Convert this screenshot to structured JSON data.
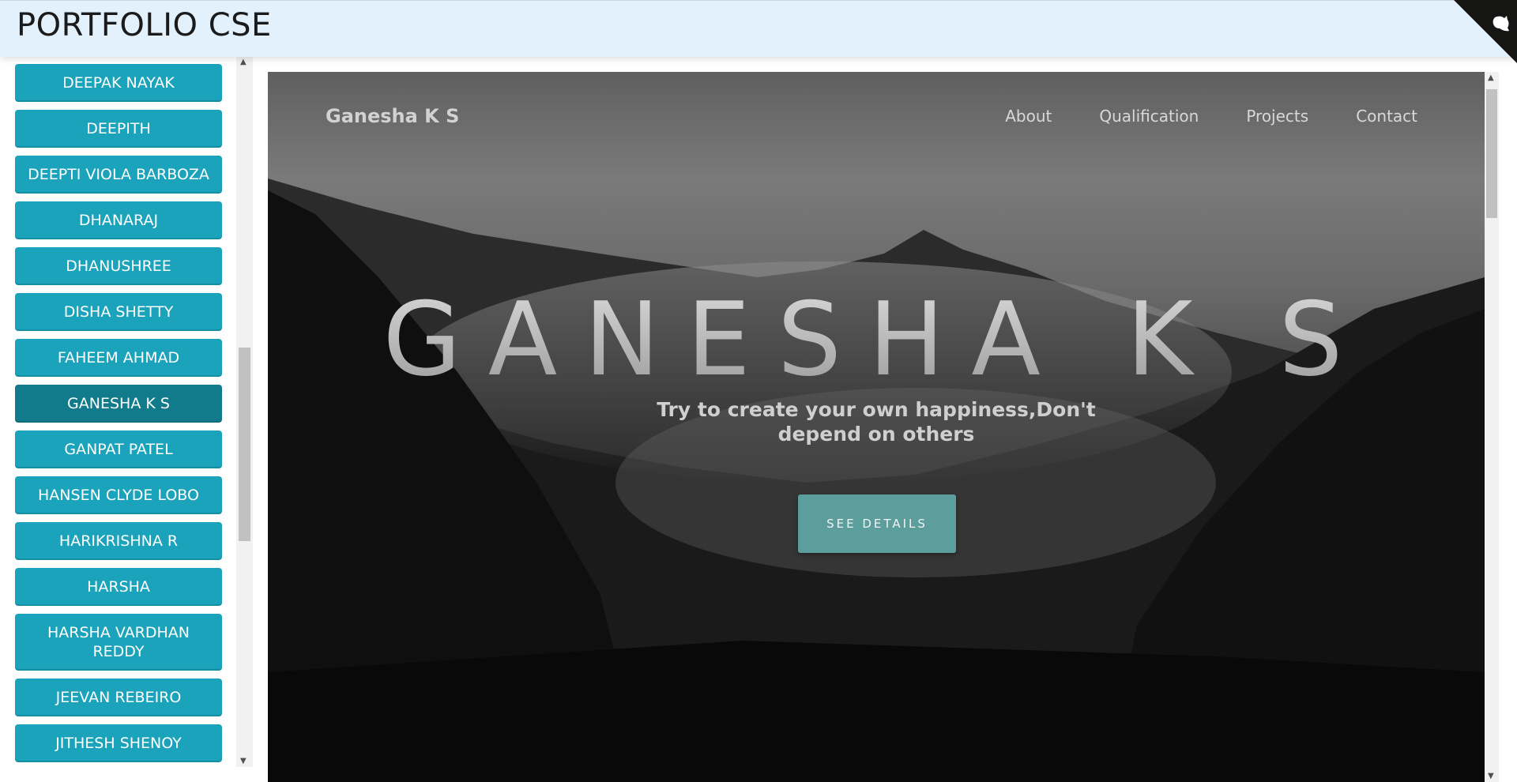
{
  "header": {
    "title": "PORTFOLIO CSE",
    "corner_icon": "github-cat-icon"
  },
  "sidebar": {
    "items": [
      {
        "label": "DEEPAK NAYAK",
        "active": false
      },
      {
        "label": "DEEPITH",
        "active": false
      },
      {
        "label": "DEEPTI VIOLA BARBOZA",
        "active": false
      },
      {
        "label": "DHANARAJ",
        "active": false
      },
      {
        "label": "DHANUSHREE",
        "active": false
      },
      {
        "label": "DISHA SHETTY",
        "active": false
      },
      {
        "label": "FAHEEM AHMAD",
        "active": false
      },
      {
        "label": "GANESHA K S",
        "active": true
      },
      {
        "label": "GANPAT PATEL",
        "active": false
      },
      {
        "label": "HANSEN CLYDE LOBO",
        "active": false
      },
      {
        "label": "HARIKRISHNA R",
        "active": false
      },
      {
        "label": "HARSHA",
        "active": false
      },
      {
        "label": "HARSHA VARDHAN REDDY",
        "active": false
      },
      {
        "label": "JEEVAN REBEIRO",
        "active": false
      },
      {
        "label": "JITHESH SHENOY",
        "active": false
      }
    ]
  },
  "preview": {
    "brand": "Ganesha K S",
    "nav": [
      "About",
      "Qualification",
      "Projects",
      "Contact"
    ],
    "hero_title": "GANESHA K S",
    "hero_subtitle": "Try to create your own happiness,Don't depend on others",
    "cta_label": "SEE DETAILS"
  },
  "colors": {
    "header_bg": "#e3f1fc",
    "sidebar_button": "#1aa3bb",
    "sidebar_button_active": "#117a8b",
    "cta_button": "#5c9e9c"
  }
}
